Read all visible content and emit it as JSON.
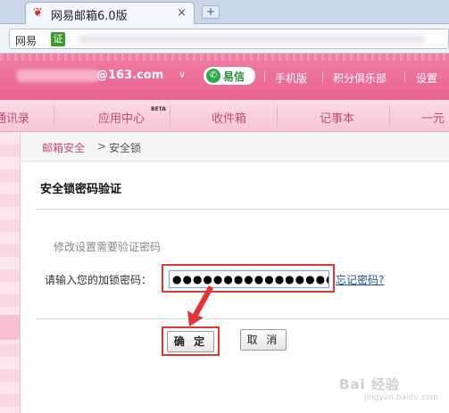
{
  "browser": {
    "tab_title": "网易邮箱6.0版",
    "tab_close": "×",
    "new_tab": "+",
    "address_label": "网易",
    "address_cert": "证"
  },
  "header": {
    "account_domain": "@163.com",
    "caret": "∨",
    "yixin_label": "易信",
    "links": [
      "手机版",
      "积分俱乐部",
      "设置"
    ]
  },
  "nav": {
    "items": [
      "通讯录",
      "应用中心",
      "收件箱",
      "记事本",
      "一元"
    ],
    "beta": "BETA"
  },
  "breadcrumb": {
    "home": "邮箱安全",
    "sep": ">",
    "current": "安全锁"
  },
  "panel": {
    "title": "安全锁密码验证",
    "hint": "修改设置需要验证密码",
    "password_label": "请输入您的加锁密码：",
    "password_value": "●●●●●●●●●●●●●●●●",
    "forgot_link": "忘记密码?",
    "confirm_button": "确 定",
    "cancel_button": "取 消"
  },
  "watermark": {
    "main": "Bai 经验",
    "sub": "jingyan.baidu.com"
  },
  "colors": {
    "brand_pink": "#f07ea4",
    "highlight_red": "#e23434",
    "link_blue": "#1f4d9c"
  }
}
